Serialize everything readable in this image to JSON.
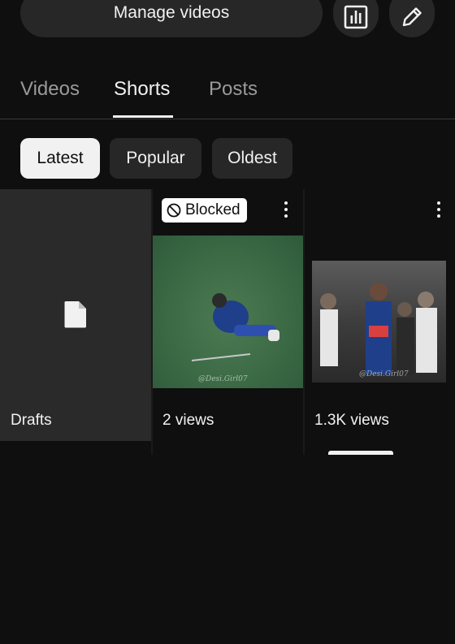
{
  "header": {
    "manage_label": "Manage videos",
    "analytics_icon": "bar-chart-icon",
    "edit_icon": "pencil-icon"
  },
  "tabs": [
    {
      "label": "Videos",
      "selected": false
    },
    {
      "label": "Shorts",
      "selected": true
    },
    {
      "label": "Posts",
      "selected": false
    }
  ],
  "filters": [
    {
      "label": "Latest",
      "selected": true
    },
    {
      "label": "Popular",
      "selected": false
    },
    {
      "label": "Oldest",
      "selected": false
    }
  ],
  "grid": {
    "drafts": {
      "label": "Drafts",
      "icon": "file-icon"
    },
    "shorts": [
      {
        "badge": "Blocked",
        "watermark": "@Desi.Girl07",
        "views": "2 views"
      },
      {
        "watermark": "@Desi.Girl07",
        "views": "1.3K views"
      }
    ]
  },
  "colors": {
    "background": "#0f0f0f",
    "surface": "#272727",
    "text": "#f1f1f1",
    "muted": "#9a9a9a",
    "selected_chip": "#f1f1f1"
  }
}
